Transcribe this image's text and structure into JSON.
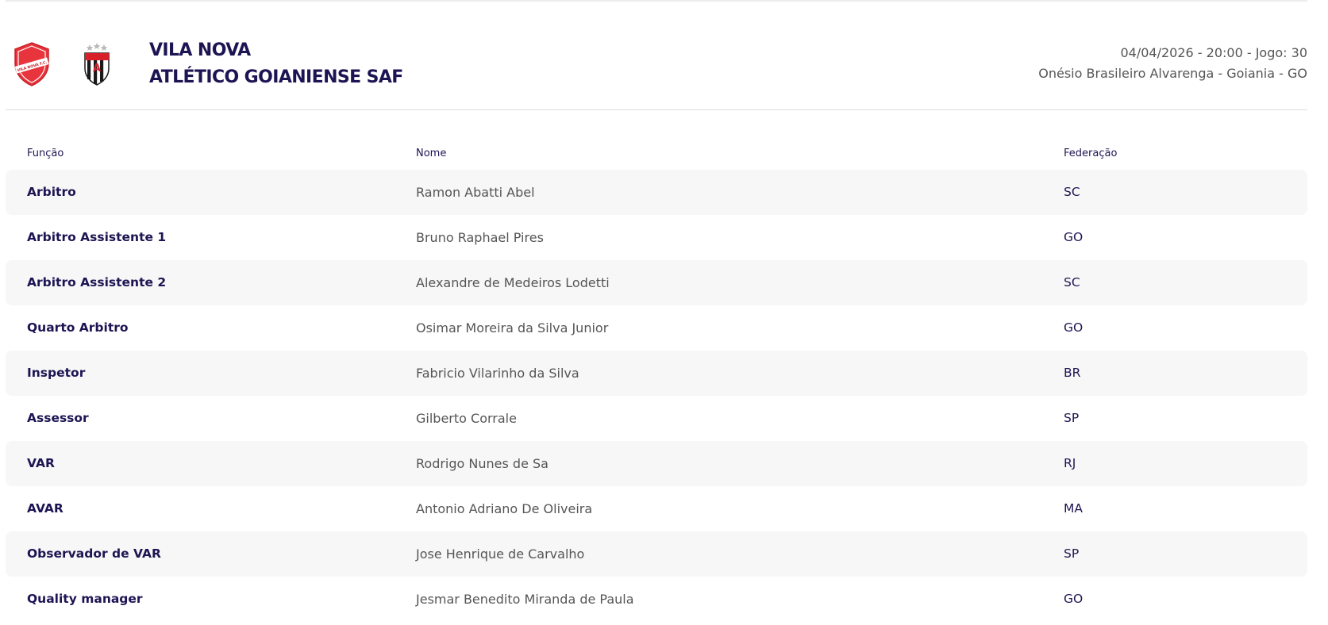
{
  "match": {
    "home_team": "VILA NOVA",
    "away_team": "ATLÉTICO GOIANIENSE SAF",
    "home_crest_text": "VILA NOVA F.C.",
    "datetime_game": "04/04/2026 - 20:00 - Jogo: 30",
    "venue": "Onésio Brasileiro Alvarenga - Goiania - GO",
    "colors": {
      "home_red": "#e8343c",
      "away_red": "#d8202a",
      "text_navy": "#1d1553"
    },
    "icons": {
      "home": "vila-nova-crest-icon",
      "away": "atletico-goianiense-crest-icon"
    }
  },
  "officials": {
    "headers": {
      "role": "Função",
      "name": "Nome",
      "federation": "Federação"
    },
    "rows": [
      {
        "role": "Arbitro",
        "name": "Ramon Abatti Abel",
        "federation": "SC"
      },
      {
        "role": "Arbitro Assistente 1",
        "name": "Bruno Raphael Pires",
        "federation": "GO"
      },
      {
        "role": "Arbitro Assistente 2",
        "name": "Alexandre de Medeiros Lodetti",
        "federation": "SC"
      },
      {
        "role": "Quarto Arbitro",
        "name": "Osimar Moreira da Silva Junior",
        "federation": "GO"
      },
      {
        "role": "Inspetor",
        "name": "Fabricio Vilarinho da Silva",
        "federation": "BR"
      },
      {
        "role": "Assessor",
        "name": "Gilberto Corrale",
        "federation": "SP"
      },
      {
        "role": "VAR",
        "name": "Rodrigo Nunes de Sa",
        "federation": "RJ"
      },
      {
        "role": "AVAR",
        "name": "Antonio Adriano De Oliveira",
        "federation": "MA"
      },
      {
        "role": "Observador de VAR",
        "name": "Jose Henrique de Carvalho",
        "federation": "SP"
      },
      {
        "role": "Quality manager",
        "name": "Jesmar Benedito Miranda de Paula",
        "federation": "GO"
      }
    ]
  }
}
